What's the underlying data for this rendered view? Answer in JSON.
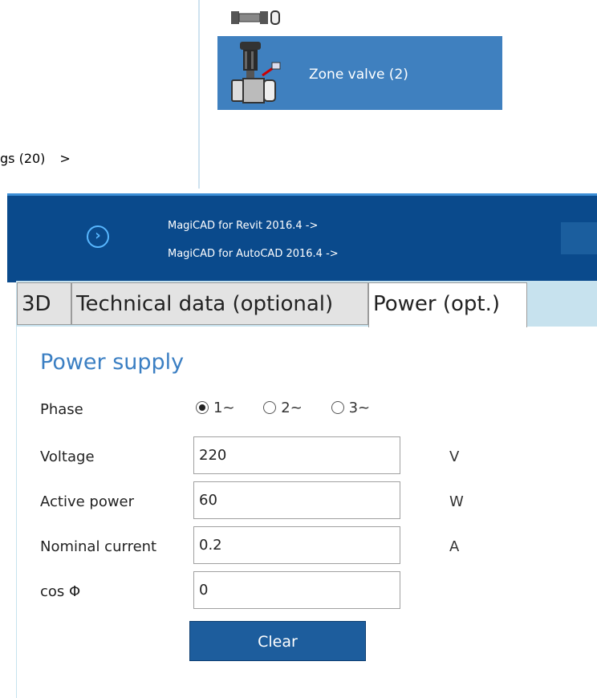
{
  "top": {
    "zone_item_label": "Zone valve (2)",
    "crumb_label": "gs (20)",
    "crumb_arrow": ">"
  },
  "banner": {
    "link1": "MagiCAD for Revit 2016.4 ->",
    "link2": "MagiCAD for AutoCAD 2016.4 ->",
    "button_glyph": "›"
  },
  "tabs": [
    "3D",
    "Technical data (optional)",
    "Power (opt.)"
  ],
  "active_tab": "Power (opt.)",
  "power": {
    "section_title": "Power supply",
    "phase_label": "Phase",
    "phase_options": [
      "1~",
      "2~",
      "3~"
    ],
    "phase_selected": "1~",
    "voltage_label": "Voltage",
    "voltage_value": "220",
    "voltage_unit": "V",
    "active_power_label": "Active power",
    "active_power_value": "60",
    "active_power_unit": "W",
    "nominal_current_label": "Nominal current",
    "nominal_current_value": "0.2",
    "nominal_current_unit": "A",
    "cos_label": "cos Φ",
    "cos_value": "0",
    "clear_label": "Clear"
  },
  "colors": {
    "banner_bg": "#0a4a8c",
    "selected_item_bg": "#3f80bf",
    "section_title": "#3b7fc3",
    "button_bg": "#1d5d9d"
  }
}
